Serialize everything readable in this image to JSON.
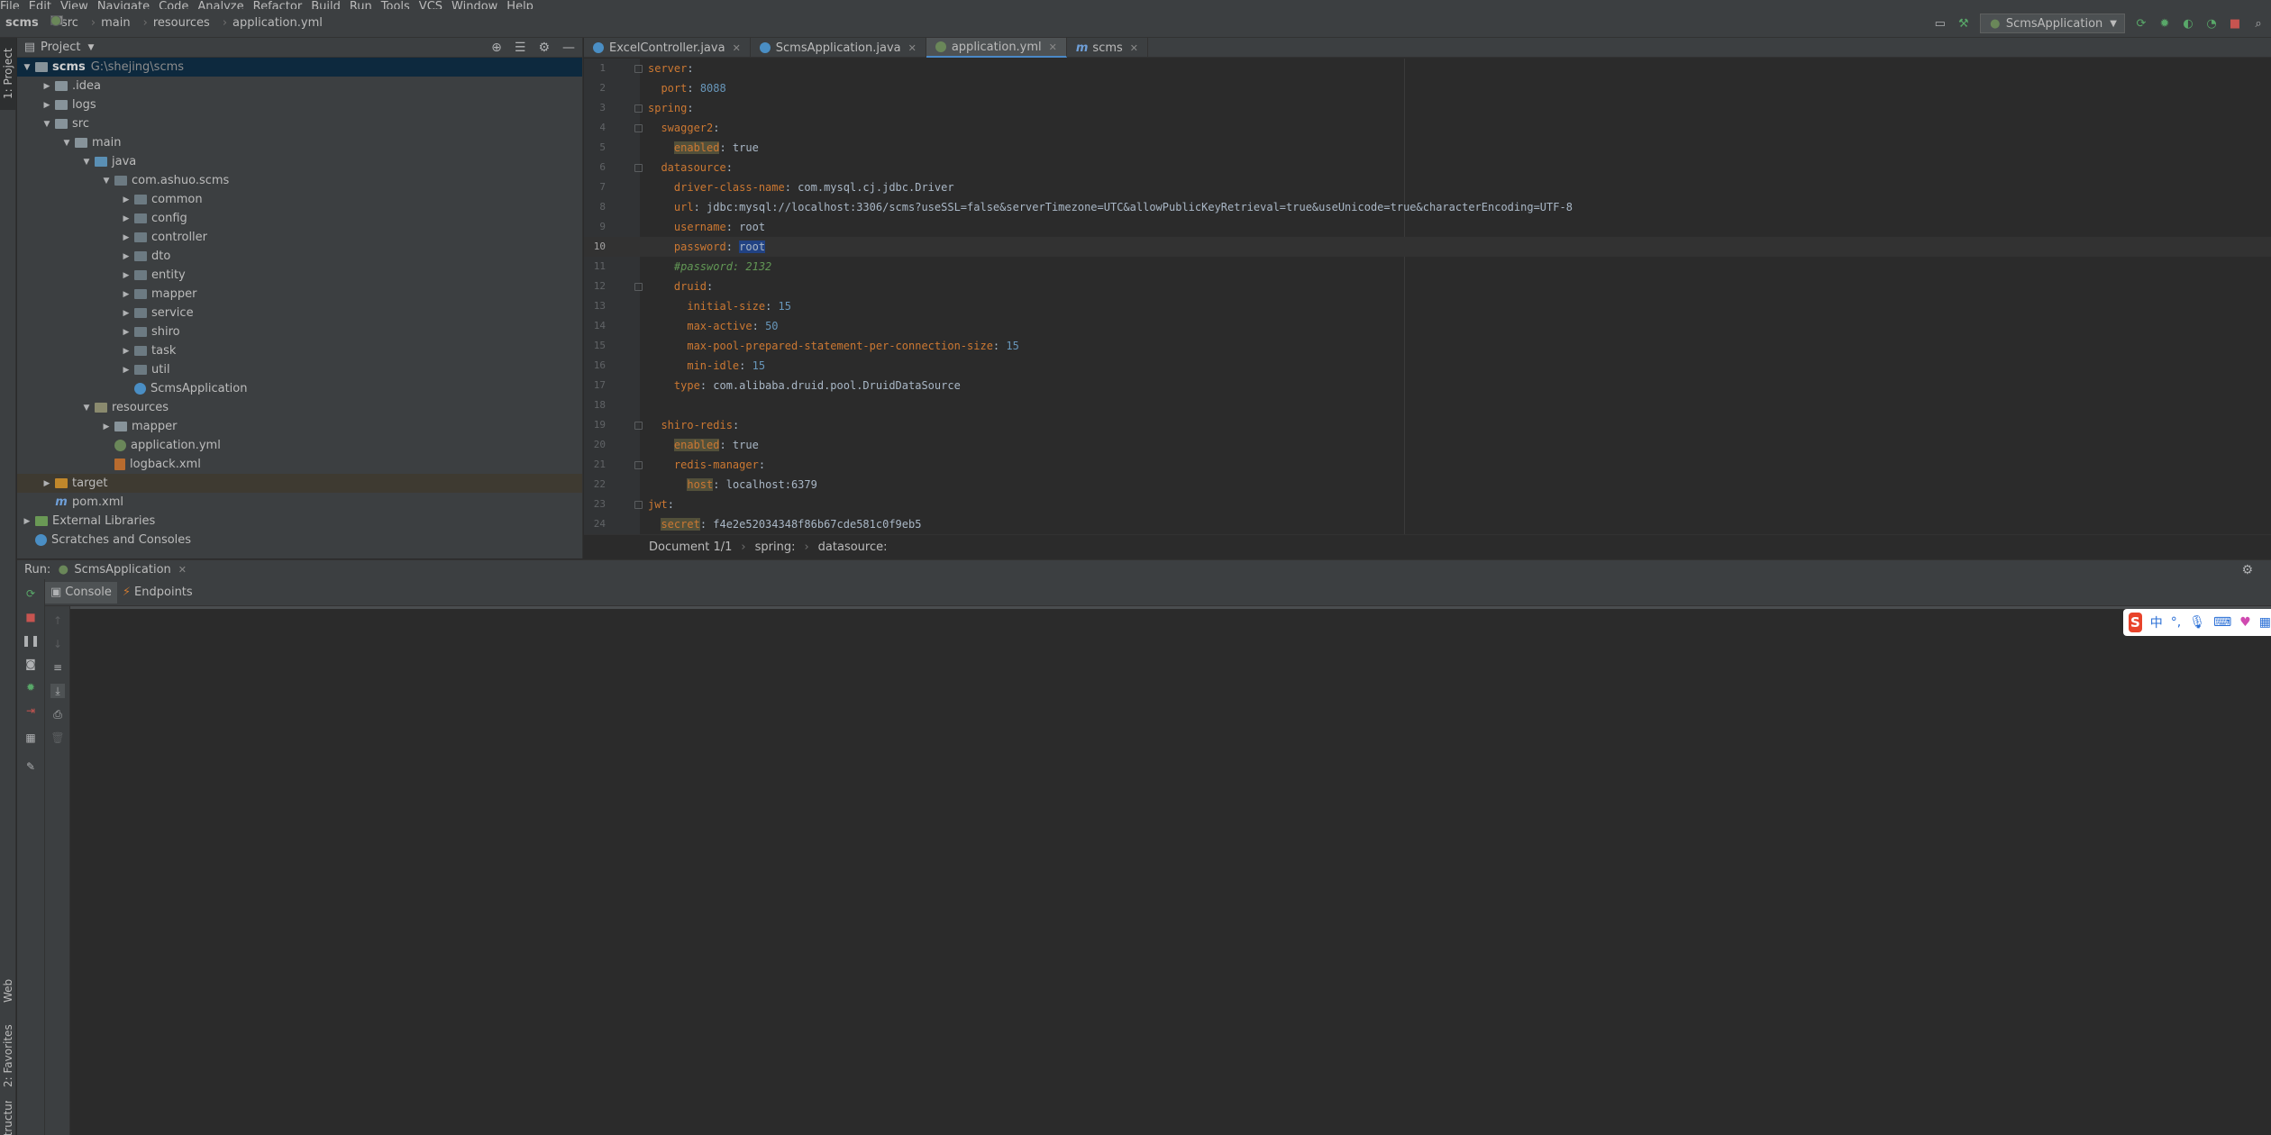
{
  "menu": [
    "File",
    "Edit",
    "View",
    "Navigate",
    "Code",
    "Analyze",
    "Refactor",
    "Build",
    "Run",
    "Tools",
    "VCS",
    "Window",
    "Help"
  ],
  "breadcrumb": [
    "scms",
    "src",
    "main",
    "resources",
    "application.yml"
  ],
  "run_config": "ScmsApplication",
  "left_tabs": [
    "1: Project",
    "Web",
    "2: Favorites",
    "Structure"
  ],
  "project_panel": {
    "title": "Project",
    "tree": [
      {
        "label": "scms",
        "path": "G:\\shejing\\scms",
        "depth": 0,
        "arrow": "▼",
        "icon": "folder",
        "bold": true,
        "selected": true
      },
      {
        "label": ".idea",
        "depth": 1,
        "arrow": "▶",
        "icon": "folder"
      },
      {
        "label": "logs",
        "depth": 1,
        "arrow": "▶",
        "icon": "folder"
      },
      {
        "label": "src",
        "depth": 1,
        "arrow": "▼",
        "icon": "folder"
      },
      {
        "label": "main",
        "depth": 2,
        "arrow": "▼",
        "icon": "folder"
      },
      {
        "label": "java",
        "depth": 3,
        "arrow": "▼",
        "icon": "src"
      },
      {
        "label": "com.ashuo.scms",
        "depth": 4,
        "arrow": "▼",
        "icon": "pkg"
      },
      {
        "label": "common",
        "depth": 5,
        "arrow": "▶",
        "icon": "pkg"
      },
      {
        "label": "config",
        "depth": 5,
        "arrow": "▶",
        "icon": "pkg"
      },
      {
        "label": "controller",
        "depth": 5,
        "arrow": "▶",
        "icon": "pkg"
      },
      {
        "label": "dto",
        "depth": 5,
        "arrow": "▶",
        "icon": "pkg"
      },
      {
        "label": "entity",
        "depth": 5,
        "arrow": "▶",
        "icon": "pkg"
      },
      {
        "label": "mapper",
        "depth": 5,
        "arrow": "▶",
        "icon": "pkg"
      },
      {
        "label": "service",
        "depth": 5,
        "arrow": "▶",
        "icon": "pkg"
      },
      {
        "label": "shiro",
        "depth": 5,
        "arrow": "▶",
        "icon": "pkg"
      },
      {
        "label": "task",
        "depth": 5,
        "arrow": "▶",
        "icon": "pkg"
      },
      {
        "label": "util",
        "depth": 5,
        "arrow": "▶",
        "icon": "pkg"
      },
      {
        "label": "ScmsApplication",
        "depth": 5,
        "arrow": "",
        "icon": "cls"
      },
      {
        "label": "resources",
        "depth": 3,
        "arrow": "▼",
        "icon": "res"
      },
      {
        "label": "mapper",
        "depth": 4,
        "arrow": "▶",
        "icon": "folder"
      },
      {
        "label": "application.yml",
        "depth": 4,
        "arrow": "",
        "icon": "yml"
      },
      {
        "label": "logback.xml",
        "depth": 4,
        "arrow": "",
        "icon": "xml"
      },
      {
        "label": "target",
        "depth": 1,
        "arrow": "▶",
        "icon": "orange",
        "highlight": true
      },
      {
        "label": "pom.xml",
        "depth": 1,
        "arrow": "",
        "icon": "mav"
      },
      {
        "label": "External Libraries",
        "depth": 0,
        "arrow": "▶",
        "icon": "lib"
      },
      {
        "label": "Scratches and Consoles",
        "depth": 0,
        "arrow": "",
        "icon": "scr"
      }
    ]
  },
  "editor_tabs": [
    {
      "label": "ExcelController.java",
      "icon_color": "#4a8ec4",
      "active": false
    },
    {
      "label": "ScmsApplication.java",
      "icon_color": "#4a8ec4",
      "active": false
    },
    {
      "label": "application.yml",
      "icon_color": "#6a8759",
      "active": true
    },
    {
      "label": "scms",
      "icon_color": "",
      "active": false
    }
  ],
  "code": [
    [
      [
        "k",
        "server"
      ],
      [
        "v",
        ":"
      ]
    ],
    [
      [
        "v",
        "  "
      ],
      [
        "k",
        "port"
      ],
      [
        "v",
        ": "
      ],
      [
        "n",
        "8088"
      ]
    ],
    [
      [
        "k",
        "spring"
      ],
      [
        "v",
        ":"
      ]
    ],
    [
      [
        "v",
        "  "
      ],
      [
        "k",
        "swagger2"
      ],
      [
        "v",
        ":"
      ]
    ],
    [
      [
        "v",
        "    "
      ],
      [
        "kb",
        "enabled"
      ],
      [
        "v",
        ": true"
      ]
    ],
    [
      [
        "v",
        "  "
      ],
      [
        "k",
        "datasource"
      ],
      [
        "v",
        ":"
      ]
    ],
    [
      [
        "v",
        "    "
      ],
      [
        "k",
        "driver-class-name"
      ],
      [
        "v",
        ": com.mysql.cj.jdbc.Driver"
      ]
    ],
    [
      [
        "v",
        "    "
      ],
      [
        "k",
        "url"
      ],
      [
        "v",
        ": jdbc:mysql://localhost:3306/scms?useSSL=false&serverTimezone=UTC&allowPublicKeyRetrieval=true&useUnicode=true&characterEncoding=UTF-8"
      ]
    ],
    [
      [
        "v",
        "    "
      ],
      [
        "k",
        "username"
      ],
      [
        "v",
        ": root"
      ]
    ],
    [
      [
        "v",
        "    "
      ],
      [
        "k",
        "password"
      ],
      [
        "v",
        ": "
      ],
      [
        "sb",
        "root"
      ]
    ],
    [
      [
        "v",
        "    "
      ],
      [
        "c",
        "#password: 2132"
      ]
    ],
    [
      [
        "v",
        "    "
      ],
      [
        "k",
        "druid"
      ],
      [
        "v",
        ":"
      ]
    ],
    [
      [
        "v",
        "      "
      ],
      [
        "k",
        "initial-size"
      ],
      [
        "v",
        ": "
      ],
      [
        "n",
        "15"
      ]
    ],
    [
      [
        "v",
        "      "
      ],
      [
        "k",
        "max-active"
      ],
      [
        "v",
        ": "
      ],
      [
        "n",
        "50"
      ]
    ],
    [
      [
        "v",
        "      "
      ],
      [
        "k",
        "max-pool-prepared-statement-per-connection-size"
      ],
      [
        "v",
        ": "
      ],
      [
        "n",
        "15"
      ]
    ],
    [
      [
        "v",
        "      "
      ],
      [
        "k",
        "min-idle"
      ],
      [
        "v",
        ": "
      ],
      [
        "n",
        "15"
      ]
    ],
    [
      [
        "v",
        "    "
      ],
      [
        "k",
        "type"
      ],
      [
        "v",
        ": com.alibaba.druid.pool.DruidDataSource"
      ]
    ],
    [],
    [
      [
        "v",
        "  "
      ],
      [
        "k",
        "shiro-redis"
      ],
      [
        "v",
        ":"
      ]
    ],
    [
      [
        "v",
        "    "
      ],
      [
        "kb",
        "enabled"
      ],
      [
        "v",
        ": true"
      ]
    ],
    [
      [
        "v",
        "    "
      ],
      [
        "k",
        "redis-manager"
      ],
      [
        "v",
        ":"
      ]
    ],
    [
      [
        "v",
        "      "
      ],
      [
        "kb",
        "host"
      ],
      [
        "v",
        ": localhost:6379"
      ]
    ],
    [
      [
        "k",
        "jwt"
      ],
      [
        "v",
        ":"
      ]
    ],
    [
      [
        "v",
        "  "
      ],
      [
        "kb",
        "secret"
      ],
      [
        "v",
        ": f4e2e52034348f86b67cde581c0f9eb5"
      ]
    ]
  ],
  "current_line": 10,
  "editor_breadcrumb": [
    "Document 1/1",
    "spring:",
    "datasource:"
  ],
  "run_panel": {
    "label": "Run:",
    "config": "ScmsApplication",
    "tabs": [
      "Console",
      "Endpoints"
    ]
  },
  "ime": {
    "logo": "S",
    "lang": "中"
  }
}
